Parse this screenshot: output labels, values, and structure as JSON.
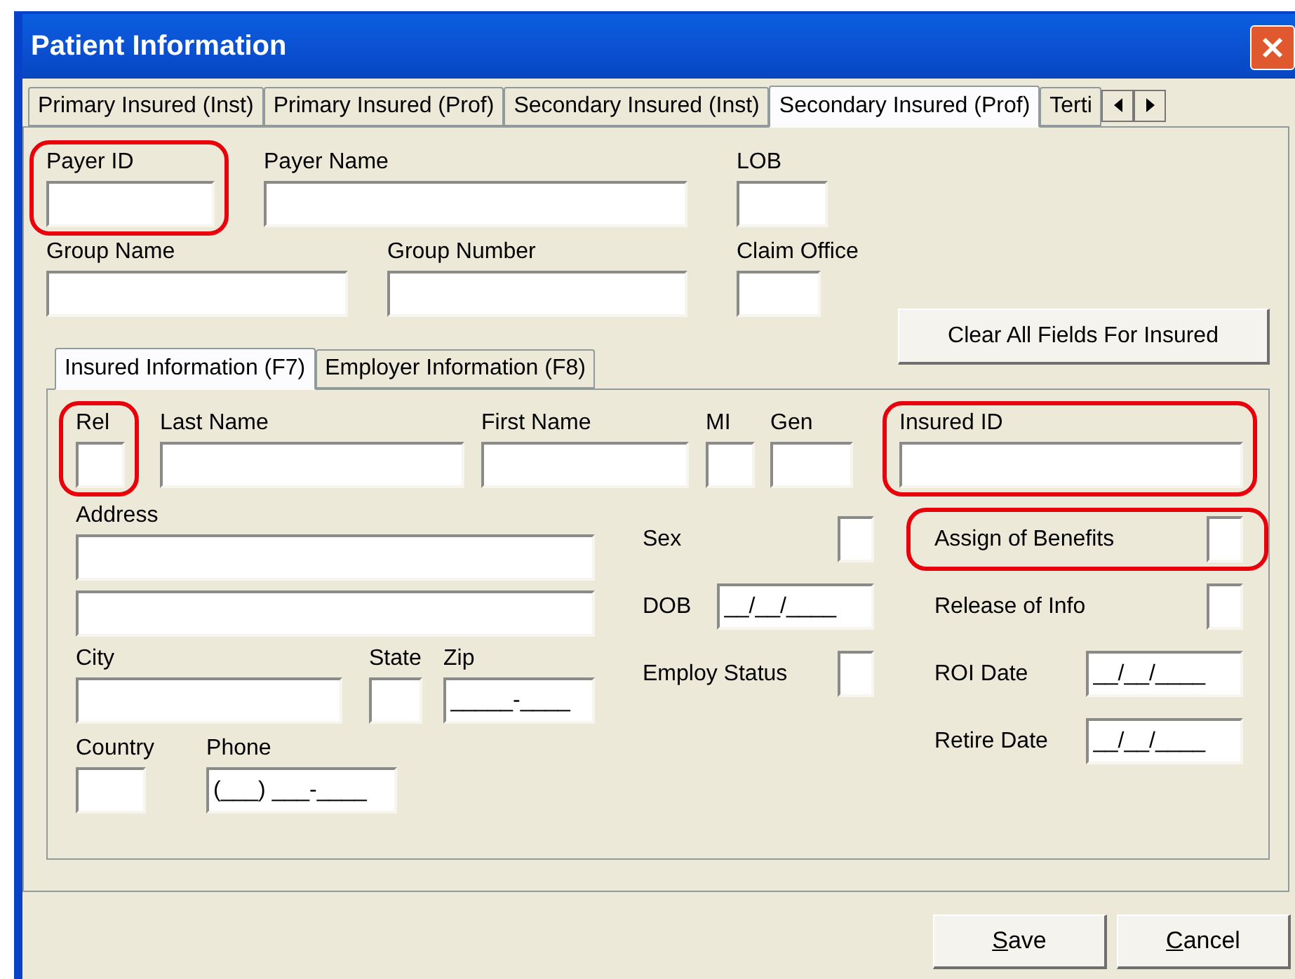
{
  "window": {
    "title": "Patient Information"
  },
  "tabs": [
    {
      "label": "Primary Insured (Inst)",
      "selected": false
    },
    {
      "label": "Primary Insured (Prof)",
      "selected": false
    },
    {
      "label": "Secondary Insured (Inst)",
      "selected": false
    },
    {
      "label": "Secondary Insured (Prof)",
      "selected": true
    },
    {
      "label": "Terti",
      "selected": false
    }
  ],
  "payer_rows": [
    [
      {
        "label": "Payer ID",
        "highlighted": true
      },
      {
        "label": "Payer Name",
        "highlighted": false
      },
      {
        "label": "LOB",
        "highlighted": false
      }
    ],
    [
      {
        "label": "Group Name",
        "highlighted": false
      },
      {
        "label": "Group Number",
        "highlighted": false
      },
      {
        "label": "Claim Office",
        "highlighted": false
      }
    ]
  ],
  "clear_button": "Clear All Fields For Insured",
  "insured_tabs": [
    {
      "label": "Insured Information (F7)",
      "selected": true
    },
    {
      "label": "Employer Information (F8)",
      "selected": false
    }
  ],
  "name_row": [
    {
      "label": "Rel",
      "highlighted": true
    },
    {
      "label": "Last Name",
      "highlighted": false
    },
    {
      "label": "First Name",
      "highlighted": false
    },
    {
      "label": "MI",
      "highlighted": false
    },
    {
      "label": "Gen",
      "highlighted": false
    },
    {
      "label": "Insured ID",
      "highlighted": true
    }
  ],
  "address": {
    "label": "Address"
  },
  "city_row": [
    {
      "label": "City"
    },
    {
      "label": "State"
    },
    {
      "label": "Zip",
      "value": "_____-____"
    }
  ],
  "country_row": [
    {
      "label": "Country"
    },
    {
      "label": "Phone",
      "value": "(___) ___-____"
    }
  ],
  "middle_fields": [
    {
      "kind": "box",
      "label": "Sex",
      "highlighted": false
    },
    {
      "kind": "date",
      "label": "DOB",
      "value": "__/__/____",
      "highlighted": false
    },
    {
      "kind": "box",
      "label": "Employ Status",
      "highlighted": false
    }
  ],
  "right_fields": [
    {
      "kind": "box",
      "label": "Assign of Benefits",
      "highlighted": true
    },
    {
      "kind": "box",
      "label": "Release of Info",
      "highlighted": false
    },
    {
      "kind": "date",
      "label": "ROI Date",
      "value": "__/__/____",
      "highlighted": false
    },
    {
      "kind": "date",
      "label": "Retire Date",
      "value": "__/__/____",
      "highlighted": false
    }
  ],
  "buttons": [
    {
      "mnemonic": "S",
      "rest": "ave"
    },
    {
      "mnemonic": "C",
      "rest": "ancel"
    }
  ]
}
